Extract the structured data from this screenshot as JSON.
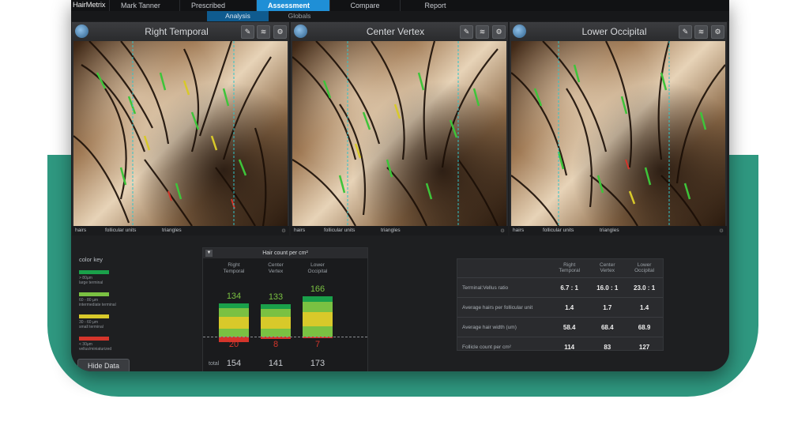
{
  "colors": {
    "accent": "#1f8fd6",
    "backdrop": "#2f9880",
    "large_terminal": "#1aa04a",
    "intermediate_terminal": "#7ac142",
    "small_terminal": "#d8c92a",
    "vellus": "#d4352b"
  },
  "nav": {
    "logo": "HairMetrix",
    "items": [
      {
        "label": "Mark Tanner",
        "active": false
      },
      {
        "label": "Prescribed Capture",
        "active": false
      },
      {
        "label": "Assessment",
        "active": true
      },
      {
        "label": "Compare",
        "active": false
      },
      {
        "label": "Report",
        "active": false
      }
    ],
    "subtabs": [
      {
        "label": "Analysis",
        "active": true
      },
      {
        "label": "Globals",
        "active": false
      }
    ]
  },
  "panels": [
    {
      "title": "Right Temporal",
      "icons": [
        "head-icon",
        "edit-icon",
        "hair-analysis-icon",
        "settings-icon"
      ]
    },
    {
      "title": "Center Vertex",
      "icons": [
        "head-icon",
        "edit-icon",
        "hair-analysis-icon",
        "settings-icon"
      ]
    },
    {
      "title": "Lower Occipital",
      "icons": [
        "head-icon",
        "edit-icon",
        "hair-analysis-icon",
        "settings-icon"
      ]
    }
  ],
  "panel_footer": {
    "hairs": "hairs",
    "follicular_units": "follicular units",
    "triangles": "triangles"
  },
  "color_key": {
    "title": "color key",
    "entries": [
      {
        "label1": "> 80µm",
        "label2": "large terminal"
      },
      {
        "label1": "60 - 80 µm",
        "label2": "intermediate terminal"
      },
      {
        "label1": "30 - 60 µm",
        "label2": "small terminal"
      },
      {
        "label1": "< 30µm",
        "label2": "vellus/miniaturized"
      }
    ]
  },
  "hide_data_label": "Hide Data",
  "hair_count": {
    "title": "Hair count per cm²",
    "total_label": "total",
    "columns": [
      {
        "line1": "Right",
        "line2": "Temporal",
        "terminal": "134",
        "vellus": "20",
        "total": "154"
      },
      {
        "line1": "Center",
        "line2": "Vertex",
        "terminal": "133",
        "vellus": "8",
        "total": "141"
      },
      {
        "line1": "Lower",
        "line2": "Occipital",
        "terminal": "166",
        "vellus": "7",
        "total": "173"
      }
    ]
  },
  "chart_data": {
    "type": "bar",
    "stacked": true,
    "categories": [
      "Right Temporal",
      "Center Vertex",
      "Lower Occipital"
    ],
    "series": [
      {
        "name": "terminal",
        "values": [
          134,
          133,
          166
        ]
      },
      {
        "name": "vellus",
        "values": [
          20,
          8,
          7
        ]
      }
    ],
    "totals": [
      154,
      141,
      173
    ],
    "title": "Hair count per cm²"
  },
  "stats": {
    "headers": [
      {
        "line1": "Right",
        "line2": "Temporal"
      },
      {
        "line1": "Center",
        "line2": "Vertex"
      },
      {
        "line1": "Lower",
        "line2": "Occipital"
      }
    ],
    "rows": [
      {
        "label": "Terminal:Vellus ratio",
        "values": [
          "6.7 : 1",
          "16.0 : 1",
          "23.0 : 1"
        ]
      },
      {
        "label": "Average hairs per follicular unit",
        "values": [
          "1.4",
          "1.7",
          "1.4"
        ]
      },
      {
        "label": "Average hair width (um)",
        "values": [
          "58.4",
          "68.4",
          "68.9"
        ]
      },
      {
        "label": "Follicle count per cm²",
        "values": [
          "114",
          "83",
          "127"
        ]
      }
    ]
  }
}
